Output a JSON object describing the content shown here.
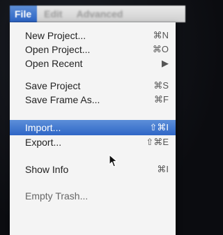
{
  "menubar": {
    "items": [
      {
        "label": "File"
      },
      {
        "label": "Edit"
      },
      {
        "label": "Advanced"
      }
    ]
  },
  "menu": {
    "items": [
      {
        "label": "New Project...",
        "shortcut": "⌘N"
      },
      {
        "label": "Open Project...",
        "shortcut": "⌘O"
      },
      {
        "label": "Open Recent",
        "shortcut": "▶"
      },
      {
        "label": "Save Project",
        "shortcut": "⌘S"
      },
      {
        "label": "Save Frame As...",
        "shortcut": "⌘F"
      },
      {
        "label": "Import...",
        "shortcut": "⇧⌘I"
      },
      {
        "label": "Export...",
        "shortcut": "⇧⌘E"
      },
      {
        "label": "Show Info",
        "shortcut": "⌘I"
      },
      {
        "label": "Empty Trash..."
      }
    ]
  },
  "colors": {
    "highlight": "#2f66c6",
    "menu_background": "#f4f4f4"
  }
}
